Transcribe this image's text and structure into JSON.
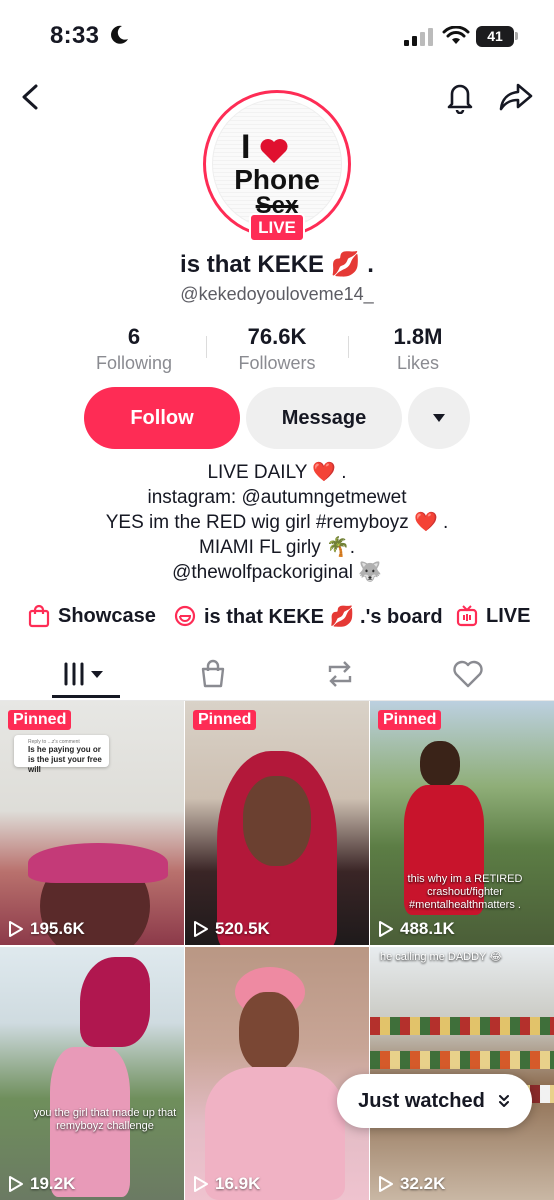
{
  "status_bar": {
    "time": "8:33",
    "battery": "41"
  },
  "profile": {
    "avatar_text": {
      "line1": "I",
      "line2": "Phone",
      "line3": "Sex"
    },
    "live_badge": "LIVE",
    "display_name": "is that KEKE 💋 .",
    "username": "@kekedoyouloveme14_"
  },
  "stats": [
    {
      "value": "6",
      "label": "Following"
    },
    {
      "value": "76.6K",
      "label": "Followers"
    },
    {
      "value": "1.8M",
      "label": "Likes"
    }
  ],
  "actions": {
    "follow": "Follow",
    "message": "Message"
  },
  "bio": [
    "LIVE DAILY ❤️ .",
    "instagram: @autumngetmewet",
    "YES im the RED wig girl #remyboyz ❤️ .",
    "MIAMI FL girly 🌴.",
    "@thewolfpackoriginal 🐺"
  ],
  "links": [
    {
      "label": "Showcase",
      "icon": "shopping-bag-icon"
    },
    {
      "label": "is that KEKE 💋 .'s board",
      "icon": "board-icon"
    },
    {
      "label": "LIVE",
      "icon": "live-tv-icon"
    }
  ],
  "tabs": [
    "videos-grid-icon",
    "shop-bag-icon",
    "repost-icon",
    "liked-heart-icon"
  ],
  "videos": [
    {
      "pinned": "Pinned",
      "views": "195.6K",
      "comment_header": "Reply to ...z's comment",
      "comment": "Is he paying you or is the just your free will"
    },
    {
      "pinned": "Pinned",
      "views": "520.5K"
    },
    {
      "pinned": "Pinned",
      "views": "488.1K",
      "caption": "this why im a RETIRED crashout/fighter #mentalhealthmatters ."
    },
    {
      "views": "19.2K",
      "caption": "you the girl that made up that remyboyz challenge"
    },
    {
      "views": "16.9K"
    },
    {
      "views": "32.2K",
      "caption": "he calling me DADDY 😂"
    }
  ],
  "just_watched": "Just watched",
  "colors": {
    "accent": "#fe2c55",
    "text": "#161823",
    "secondary": "#8a8b91"
  }
}
